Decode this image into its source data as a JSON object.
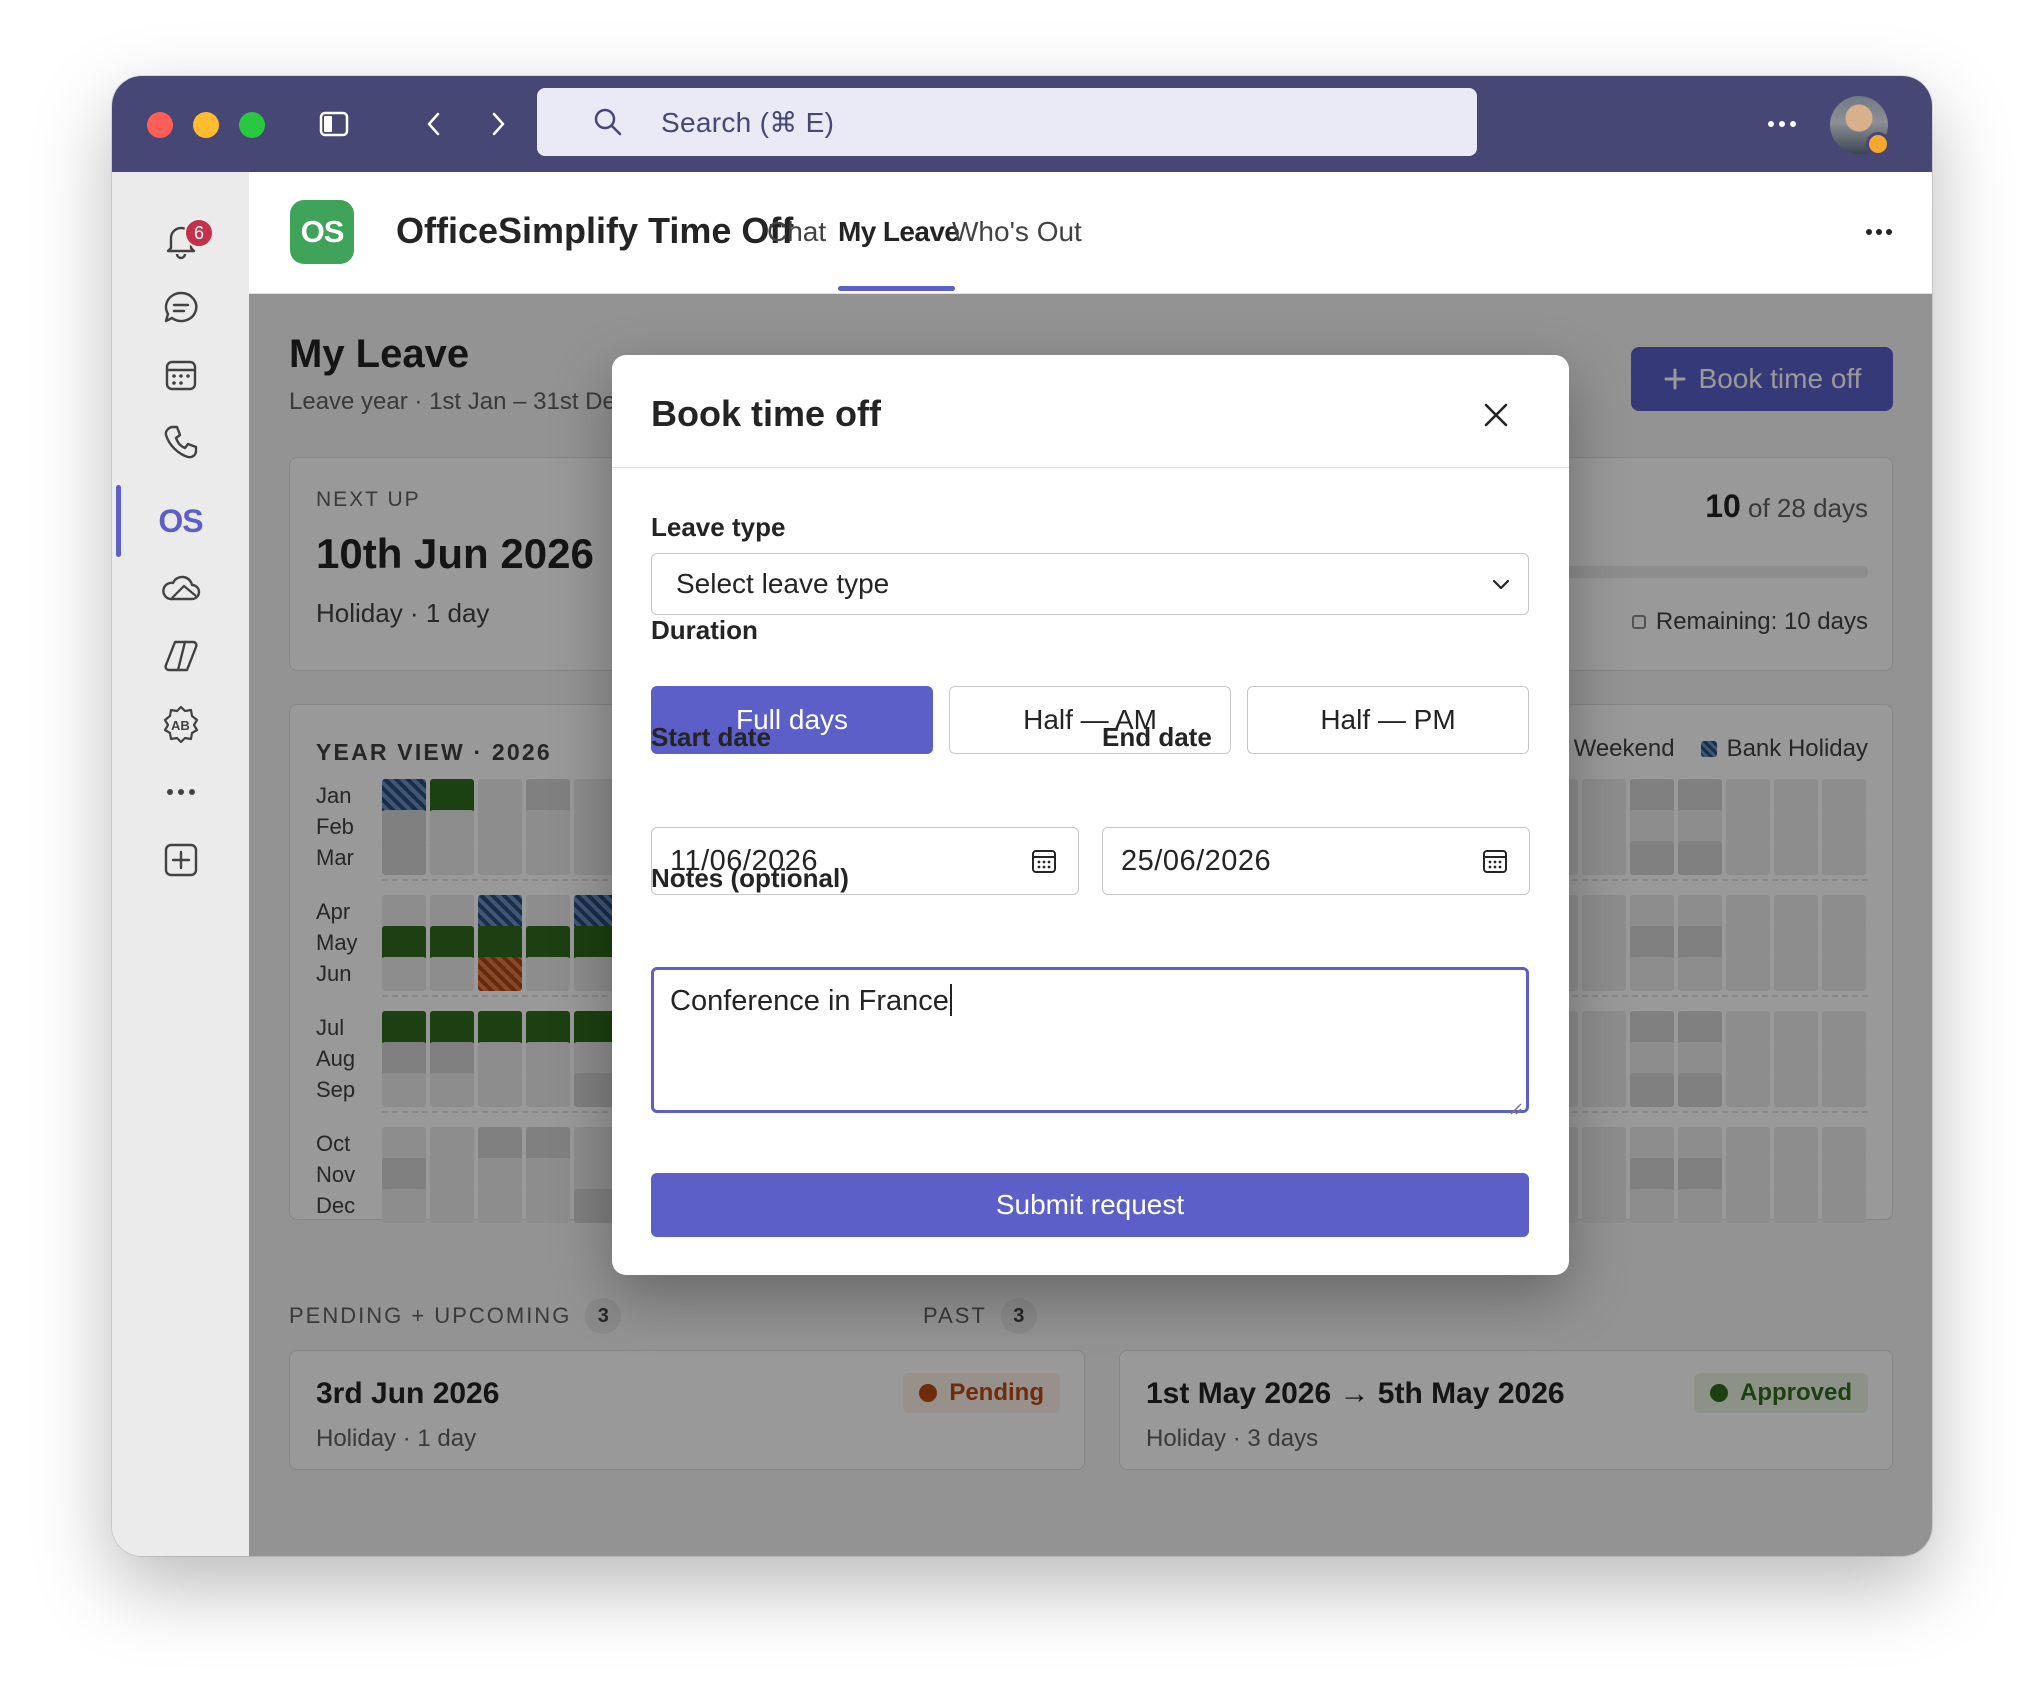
{
  "titlebar": {
    "search_placeholder": "Search (⌘ E)",
    "more_icon": "more-horizontal-icon"
  },
  "rail": {
    "notification_badge": "6",
    "items": [
      "activity",
      "chat",
      "calendar",
      "calls",
      "officesimplify",
      "onedrive",
      "copilot",
      "apps",
      "more",
      "add-app"
    ],
    "active_app_label": "OS"
  },
  "app": {
    "logo_text": "OS",
    "title": "OfficeSimplify Time Off",
    "tabs": [
      {
        "label": "Chat",
        "active": false
      },
      {
        "label": "My Leave",
        "active": true
      },
      {
        "label": "Who's Out",
        "active": false
      }
    ],
    "accent_color": "#5b5fc7"
  },
  "page": {
    "title": "My Leave",
    "subtitle": "Leave year · 1st Jan – 31st Dec 2026",
    "book_button": "Book time off"
  },
  "next_up": {
    "label": "NEXT UP",
    "date": "10th Jun 2026",
    "meta": "Holiday · 1 day"
  },
  "balance": {
    "value": "10",
    "of_text": "of 28 days",
    "remaining": "Remaining: 10 days"
  },
  "year_view": {
    "label": "YEAR VIEW · 2026",
    "legend": [
      "Weekend",
      "Bank Holiday"
    ],
    "months": [
      "Jan",
      "Feb",
      "Mar",
      "Apr",
      "May",
      "Jun",
      "Jul",
      "Aug",
      "Sep",
      "Oct",
      "Nov",
      "Dec"
    ]
  },
  "pending": {
    "label": "PENDING + UPCOMING",
    "count": "3",
    "first_item": {
      "title": "3rd Jun 2026",
      "sub": "Holiday · 1 day",
      "status": "Pending"
    }
  },
  "past": {
    "label": "PAST",
    "count": "3",
    "first_item": {
      "title": "1st May 2026 → 5th May 2026",
      "sub": "Holiday · 3 days",
      "status": "Approved"
    }
  },
  "modal": {
    "title": "Book time off",
    "leave_type_label": "Leave type",
    "leave_type_value": "Select leave type",
    "duration_label": "Duration",
    "duration_options": [
      "Full days",
      "Half — AM",
      "Half — PM"
    ],
    "duration_selected": "Full days",
    "start_label": "Start date",
    "start_value": "11/06/2026",
    "end_label": "End date",
    "end_value": "25/06/2026",
    "notes_label": "Notes (optional)",
    "notes_value": "Conference in France",
    "submit": "Submit request"
  }
}
